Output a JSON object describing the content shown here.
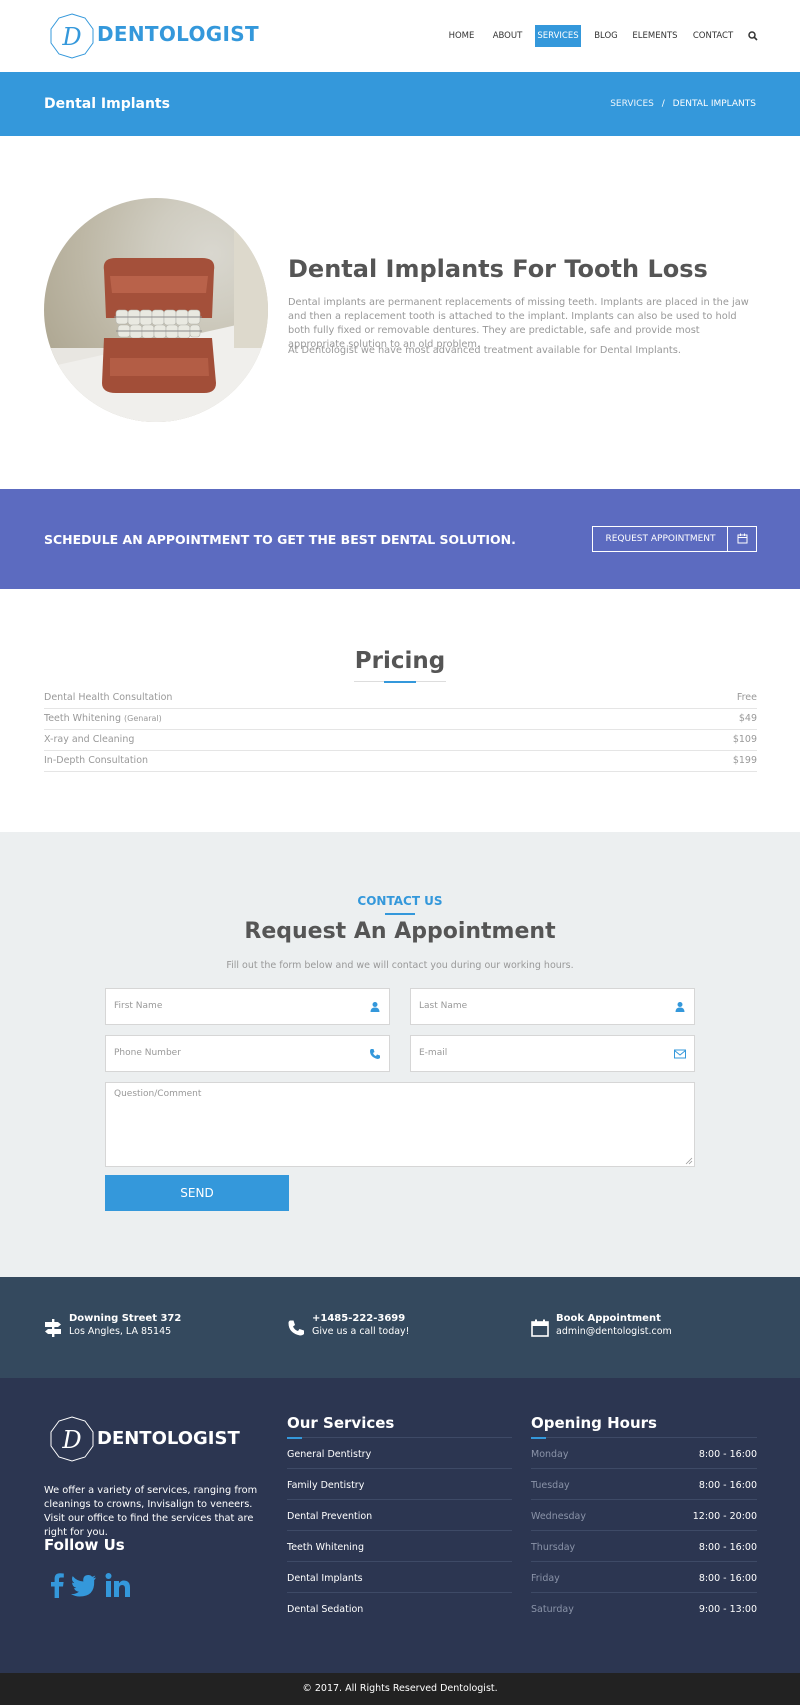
{
  "brand": {
    "name": "DENTOLOGIST",
    "monogram": "D",
    "accent": "#3498db"
  },
  "nav": {
    "items": [
      "HOME",
      "ABOUT",
      "SERVICES",
      "BLOG",
      "ELEMENTS",
      "CONTACT"
    ],
    "active": "SERVICES"
  },
  "page": {
    "title": "Dental Implants"
  },
  "breadcrumb": {
    "parent": "SERVICES",
    "separator": "/",
    "current": "DENTAL IMPLANTS"
  },
  "intro": {
    "title": "Dental Implants For Tooth Loss",
    "p1": "Dental implants are permanent replacements of missing teeth. Implants are placed in the jaw and then a replacement tooth is attached to the implant. Implants can also be used to hold both fully fixed or removable dentures. They are predictable, safe and provide most appropriate solution to an old problem.",
    "p2": "At Dentologist we have most advanced treatment available for Dental Implants."
  },
  "schedule": {
    "text": "SCHEDULE AN APPOINTMENT TO GET THE BEST DENTAL SOLUTION.",
    "button": "REQUEST APPOINTMENT",
    "color": "#5c6bc0"
  },
  "pricing": {
    "title": "Pricing",
    "rows": [
      {
        "name": "Dental Health Consultation",
        "note": "",
        "price": "Free"
      },
      {
        "name": "Teeth Whitening",
        "note": "(Genaral)",
        "price": "$49"
      },
      {
        "name": "X-ray and Cleaning",
        "note": "",
        "price": "$109"
      },
      {
        "name": "In-Depth Consultation",
        "note": "",
        "price": "$199"
      }
    ]
  },
  "contact": {
    "kicker": "CONTACT US",
    "title": "Request An Appointment",
    "description": "Fill out the form below and we will contact you during our working hours.",
    "fields": {
      "first_name": "First Name",
      "last_name": "Last Name",
      "phone": "Phone Number",
      "email": "E-mail",
      "comment": "Question/Comment"
    },
    "send": "SEND"
  },
  "info": {
    "address": {
      "line1": "Downing Street 372",
      "line2": "Los Angles, LA 85145"
    },
    "phone": {
      "line1": "+1485-222-3699",
      "line2": "Give us a call today!"
    },
    "book": {
      "line1": "Book Appointment",
      "line2": "admin@dentologist.com"
    }
  },
  "footer": {
    "about": "We offer a variety of services, ranging from cleanings to crowns, Invisalign to veneers. Visit our office to find the services that are right for you.",
    "follow": "Follow Us",
    "social": [
      "facebook-icon",
      "twitter-icon",
      "linkedin-icon"
    ],
    "services_title": "Our Services",
    "services": [
      "General Dentistry",
      "Family Dentistry",
      "Dental Prevention",
      "Teeth Whitening",
      "Dental Implants",
      "Dental Sedation"
    ],
    "hours_title": "Opening Hours",
    "hours": [
      {
        "day": "Monday",
        "time": "8:00 - 16:00"
      },
      {
        "day": "Tuesday",
        "time": "8:00 - 16:00"
      },
      {
        "day": "Wednesday",
        "time": "12:00 - 20:00"
      },
      {
        "day": "Thursday",
        "time": "8:00 - 16:00"
      },
      {
        "day": "Friday",
        "time": "8:00 - 16:00"
      },
      {
        "day": "Saturday",
        "time": "9:00 - 13:00"
      }
    ],
    "copyright": "© 2017. All Rights Reserved Dentologist."
  }
}
